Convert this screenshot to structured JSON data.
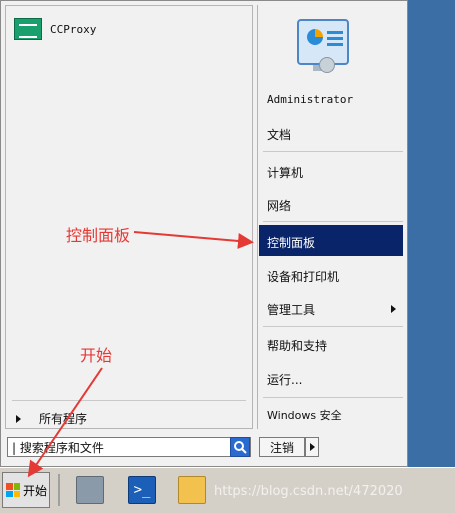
{
  "start_menu": {
    "pinned": {
      "label": "CCProxy"
    },
    "all_programs": "所有程序",
    "search": {
      "value": "| 搜索程序和文件"
    },
    "right": {
      "user": "Administrator",
      "documents": "文档",
      "computer": "计算机",
      "network": "网络",
      "control_panel": "控制面板",
      "devices_printers": "设备和打印机",
      "admin_tools": "管理工具",
      "help_support": "帮助和支持",
      "run": "运行...",
      "windows_security": "Windows 安全"
    },
    "shutdown": "注销"
  },
  "taskbar": {
    "start_label": "开始",
    "items": [
      {
        "icon": "server-manager-icon"
      },
      {
        "icon": "powershell-icon"
      },
      {
        "icon": "explorer-folder-icon"
      }
    ]
  },
  "annotations": {
    "control_panel_note": "控制面板",
    "start_note": "开始",
    "watermark": "https://blog.csdn.net/472020"
  },
  "colors": {
    "highlight": "#0a246a",
    "annotation": "#e53935",
    "desktop": "#3a6ea5"
  }
}
